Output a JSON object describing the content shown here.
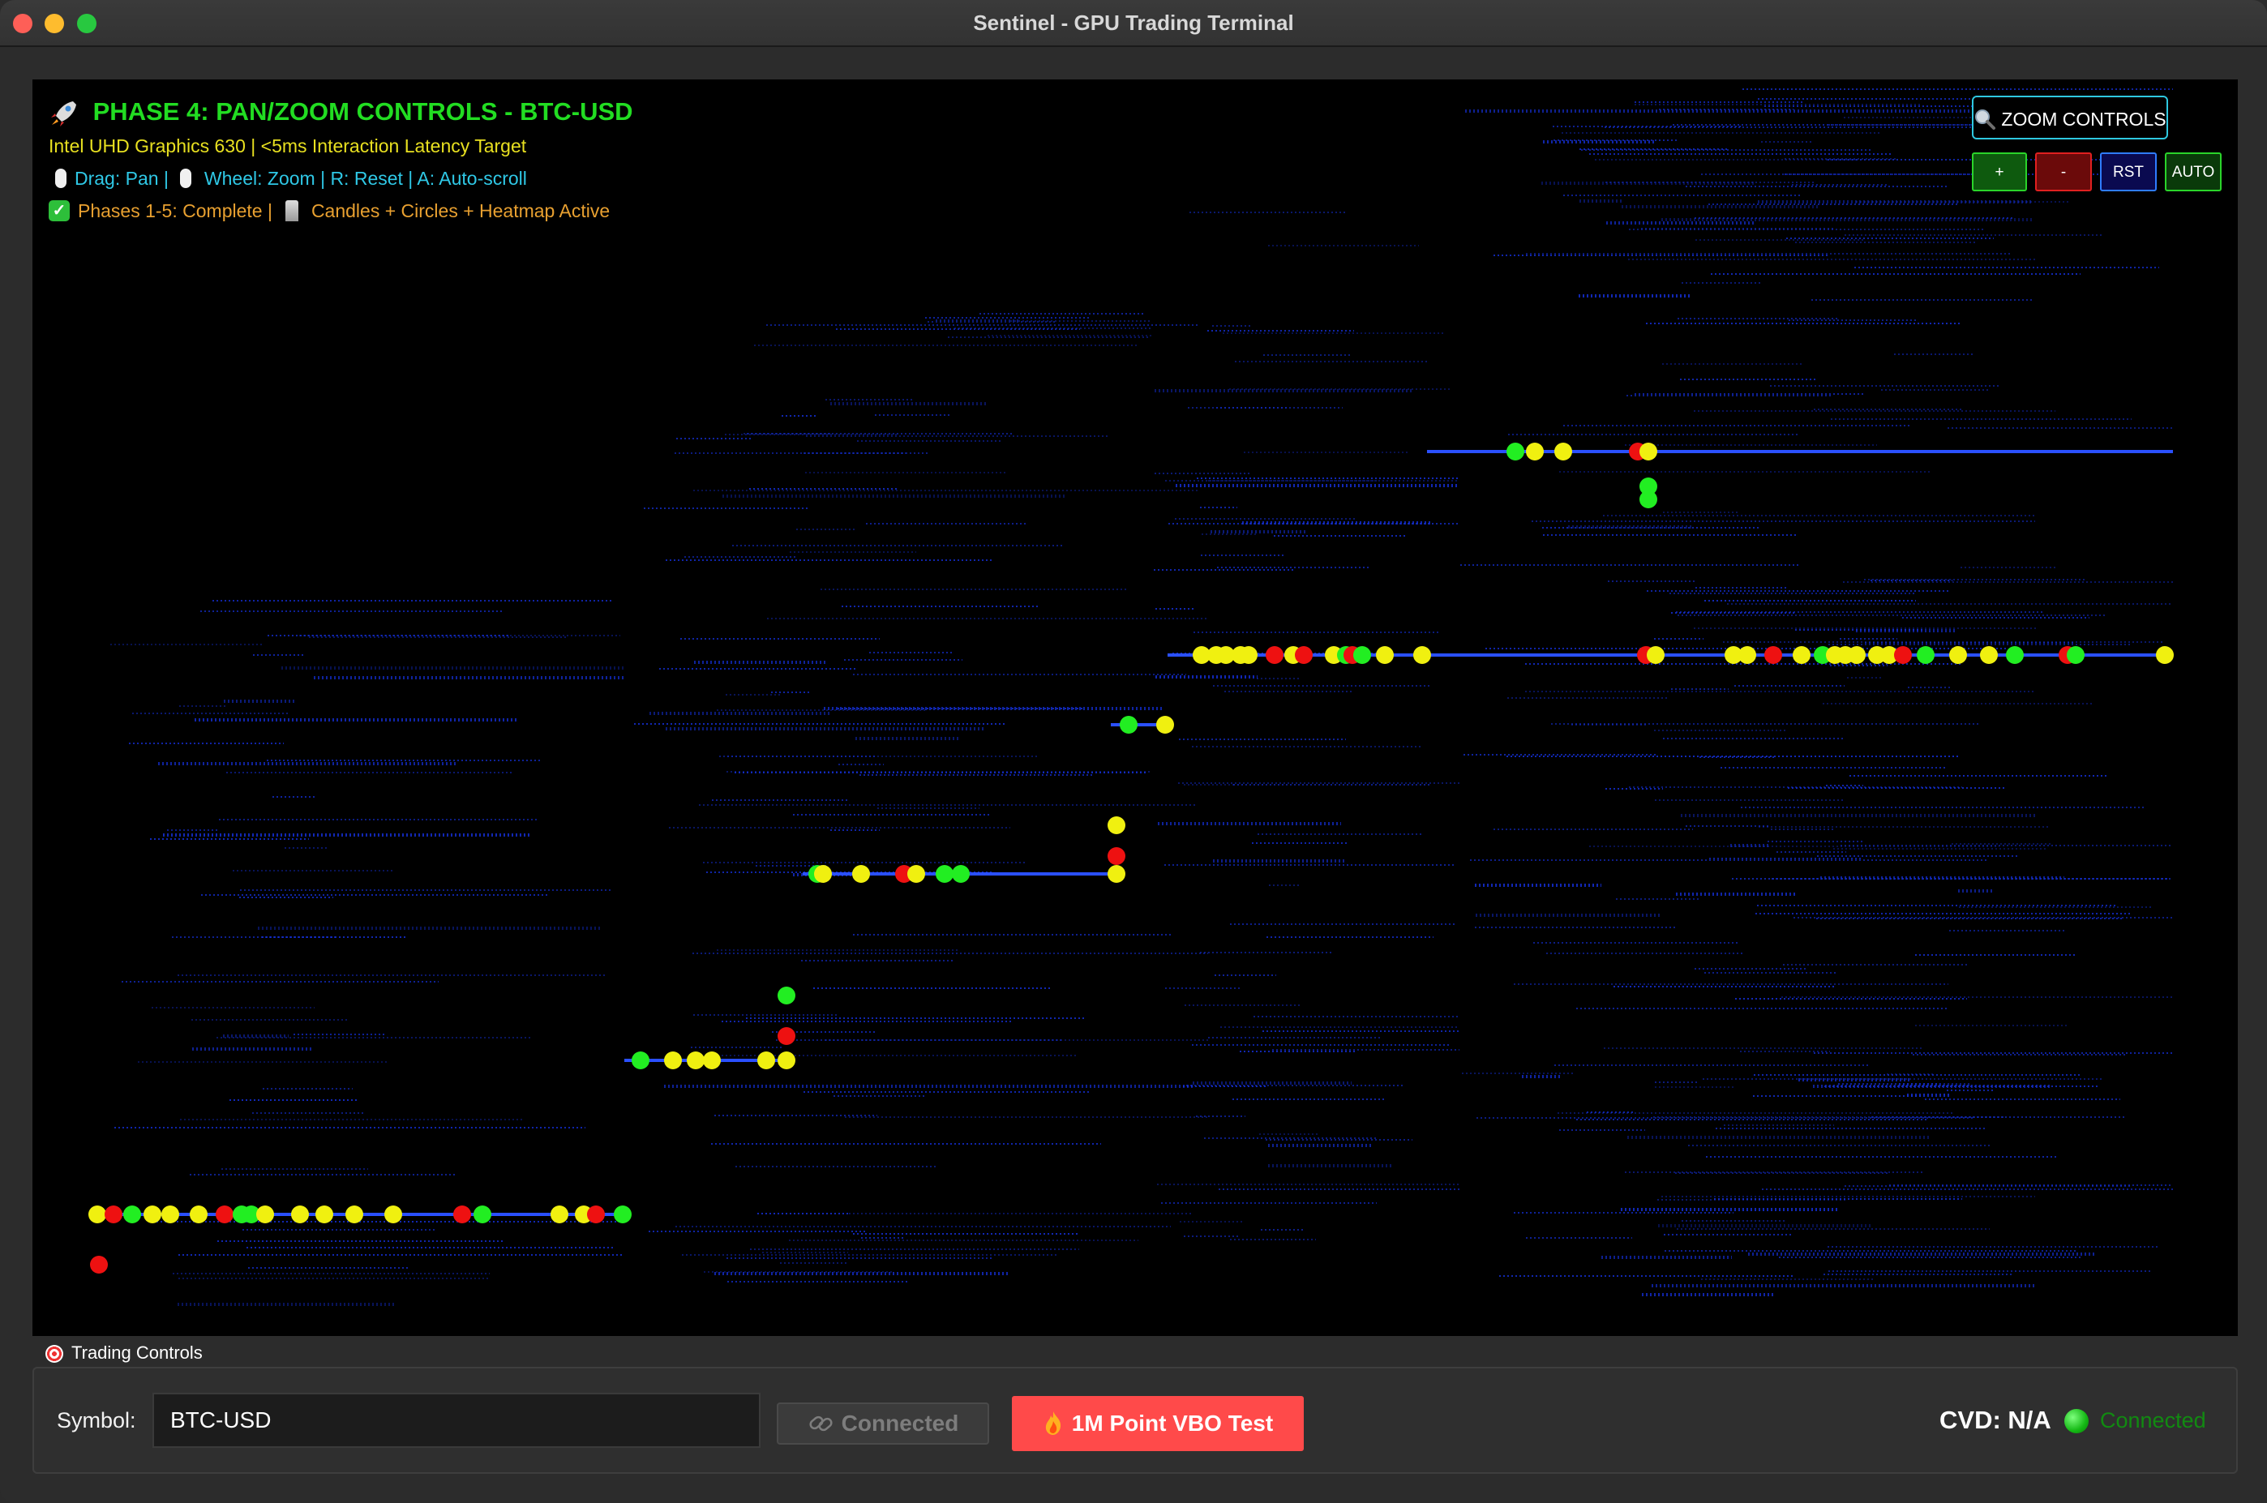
{
  "window": {
    "title": "Sentinel - GPU Trading Terminal"
  },
  "overlay": {
    "title": "PHASE 4: PAN/ZOOM CONTROLS - BTC-USD",
    "title_icon": "rocket-icon",
    "subtitle": "Intel UHD Graphics 630 | <5ms Interaction Latency Target",
    "help_drag": "Drag: Pan |",
    "help_wheel": "Wheel: Zoom | R: Reset | A: Auto-scroll",
    "phase_status": "Phases 1-5: Complete |",
    "phase_active": "Candles + Circles + Heatmap Active"
  },
  "zoom": {
    "header_label": "ZOOM CONTROLS",
    "plus_label": "+",
    "minus_label": "-",
    "reset_label": "RST",
    "auto_label": "AUTO"
  },
  "controls": {
    "group_label": "Trading Controls",
    "symbol_label": "Symbol:",
    "symbol_value": "BTC-USD",
    "connect_label": "Connected",
    "vbo_label": "1M Point VBO Test",
    "cvd_label": "CVD: N/A",
    "status_text": "Connected"
  },
  "colors": {
    "heatmap_line": "#1530d8",
    "trade_buy": "#22ee22",
    "trade_sell": "#ee1111",
    "trade_neutral": "#f0f010",
    "accent_cyan": "#2ec8e0"
  },
  "chart_data": {
    "type": "scatter",
    "description_marks": "trade circles over order-book heatmap",
    "groups": [
      {
        "level": 1,
        "count_yellow": 14,
        "count_green": 6,
        "count_red": 6
      },
      {
        "level": 2,
        "count_yellow": 6,
        "count_green": 1,
        "count_red": 0
      },
      {
        "level": 3,
        "count_yellow": 7,
        "count_green": 3,
        "count_red": 2
      },
      {
        "level": 4,
        "count_yellow": 2,
        "count_green": 1,
        "count_red": 0
      },
      {
        "level": 5,
        "count_yellow": 20,
        "count_green": 4,
        "count_red": 7
      },
      {
        "level": 6,
        "count_yellow": 4,
        "count_green": 3,
        "count_red": 1
      }
    ]
  }
}
